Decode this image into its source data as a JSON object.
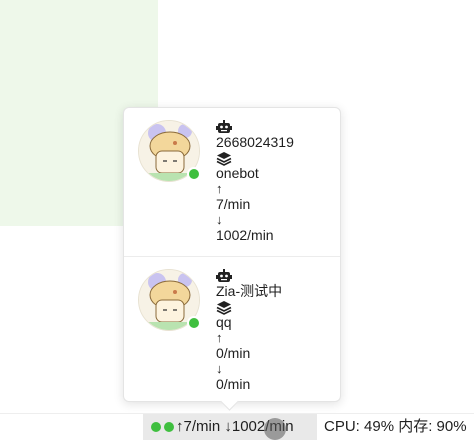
{
  "bots": [
    {
      "robot_icon": "robot-icon",
      "id": "2668024319",
      "platform_icon": "layers-icon",
      "platform": "onebot",
      "up_arrow": "↑",
      "sent_rate": "7/min",
      "down_arrow": "↓",
      "recv_rate": "1002/min",
      "status_color": "#3fbf3f"
    },
    {
      "robot_icon": "robot-icon",
      "id": "Zia-测试中",
      "platform_icon": "layers-icon",
      "platform": "qq",
      "up_arrow": "↑",
      "sent_rate": "0/min",
      "down_arrow": "↓",
      "recv_rate": "0/min",
      "status_color": "#3fbf3f"
    }
  ],
  "statusbar": {
    "rate_summary": "↑7/min ↓1002/min",
    "system_summary": "CPU: 49%  内存: 90%",
    "online_color": "#3fbf3f"
  }
}
